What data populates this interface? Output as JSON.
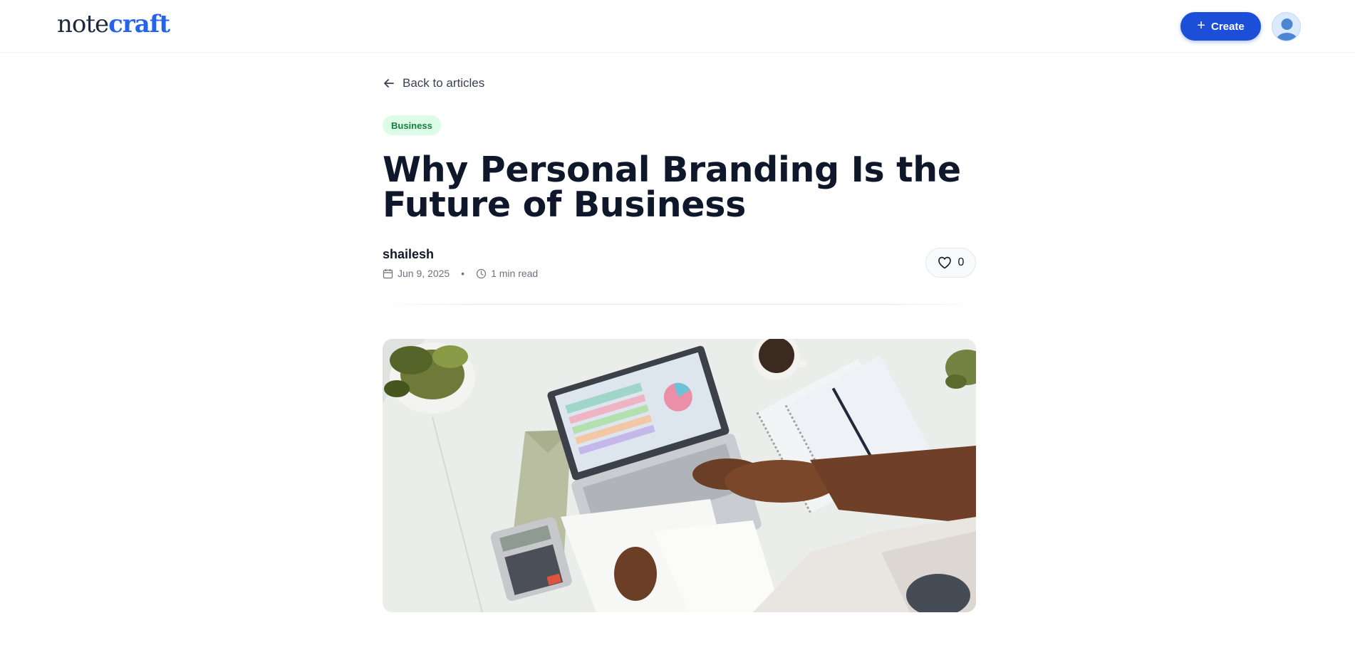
{
  "header": {
    "logo_part1": "note",
    "logo_part2": "craft",
    "create_label": "Create",
    "brand_color": "#2563eb",
    "create_bg": "#1d4ed8"
  },
  "article": {
    "back_label": "Back to articles",
    "category": "Business",
    "title": "Why Personal Branding Is the Future of Business",
    "author": "shailesh",
    "date": "Jun 9, 2025",
    "read_time": "1 min read",
    "likes": "0",
    "meta_separator": "•"
  },
  "icons": {
    "back": "arrow-left-icon",
    "calendar": "calendar-icon",
    "clock": "clock-icon",
    "heart": "heart-icon",
    "plus": "plus-icon",
    "user": "user-avatar-icon"
  },
  "colors": {
    "tag_bg": "#dcfce7",
    "tag_text": "#15803d",
    "title_text": "#0f172a"
  }
}
